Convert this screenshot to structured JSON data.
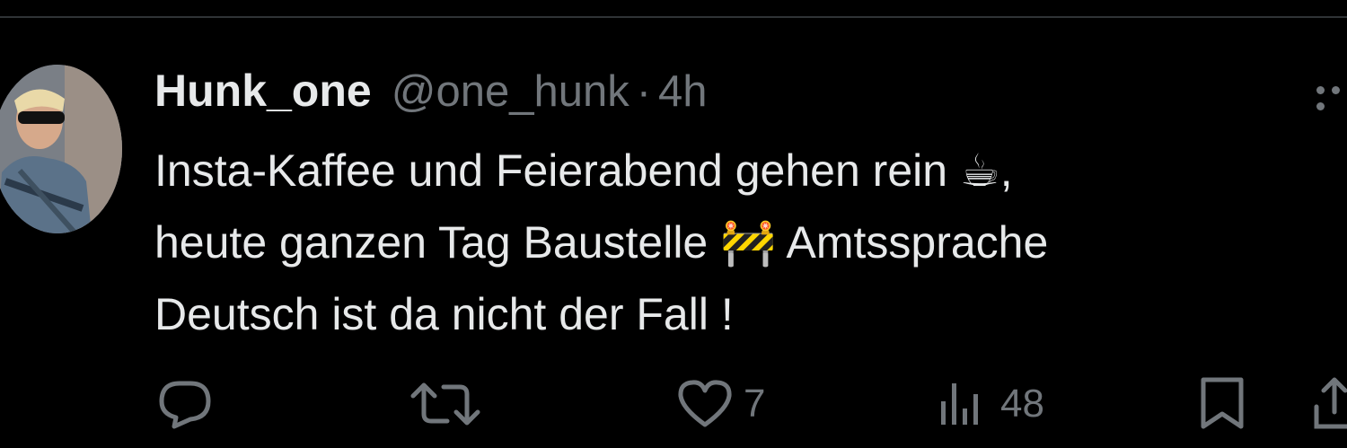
{
  "author": {
    "display_name": "Hunk_one",
    "handle": "@one_hunk",
    "separator": "·",
    "time": "4h"
  },
  "tweet": {
    "line1": "Insta-Kaffee und Feierabend gehen rein ☕,",
    "line2": "heute ganzen Tag Baustelle 🚧 Amtssprache",
    "line3": "Deutsch ist da nicht der Fall !"
  },
  "actions": {
    "reply": {
      "icon": "reply-icon",
      "count": ""
    },
    "retweet": {
      "icon": "retweet-icon",
      "count": ""
    },
    "like": {
      "icon": "heart-icon",
      "count": "7"
    },
    "views": {
      "icon": "views-icon",
      "count": "48"
    },
    "bookmark": {
      "icon": "bookmark-icon"
    },
    "share": {
      "icon": "share-icon"
    }
  },
  "colors": {
    "background": "#000000",
    "text": "#e7e9ea",
    "secondary": "#71767b",
    "divider": "#2f3336"
  }
}
